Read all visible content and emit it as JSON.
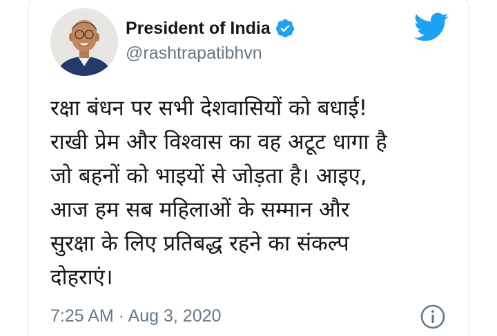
{
  "author": {
    "display_name": "President of India",
    "handle": "@rashtrapatibhvn",
    "verified": true
  },
  "tweet": {
    "lines": [
      "रक्षा बंधन पर सभी देशवासियों को बधाई!",
      "राखी प्रेम और विश्वास का वह अटूट धागा है",
      "जो बहनों को भाइयों से जोड़ता है। आइए,",
      "आज हम सब महिलाओं के सम्मान और",
      "सुरक्षा के लिए प्रतिबद्ध रहने का संकल्प",
      "दोहराएं।"
    ],
    "timestamp": "7:25 AM · Aug 3, 2020"
  },
  "icons": {
    "brand": "twitter-bird-icon",
    "verified": "verified-badge-icon",
    "info": "info-icon"
  },
  "colors": {
    "twitter_blue": "#1da1f2",
    "text_primary": "#14171a",
    "text_secondary": "#657786"
  }
}
